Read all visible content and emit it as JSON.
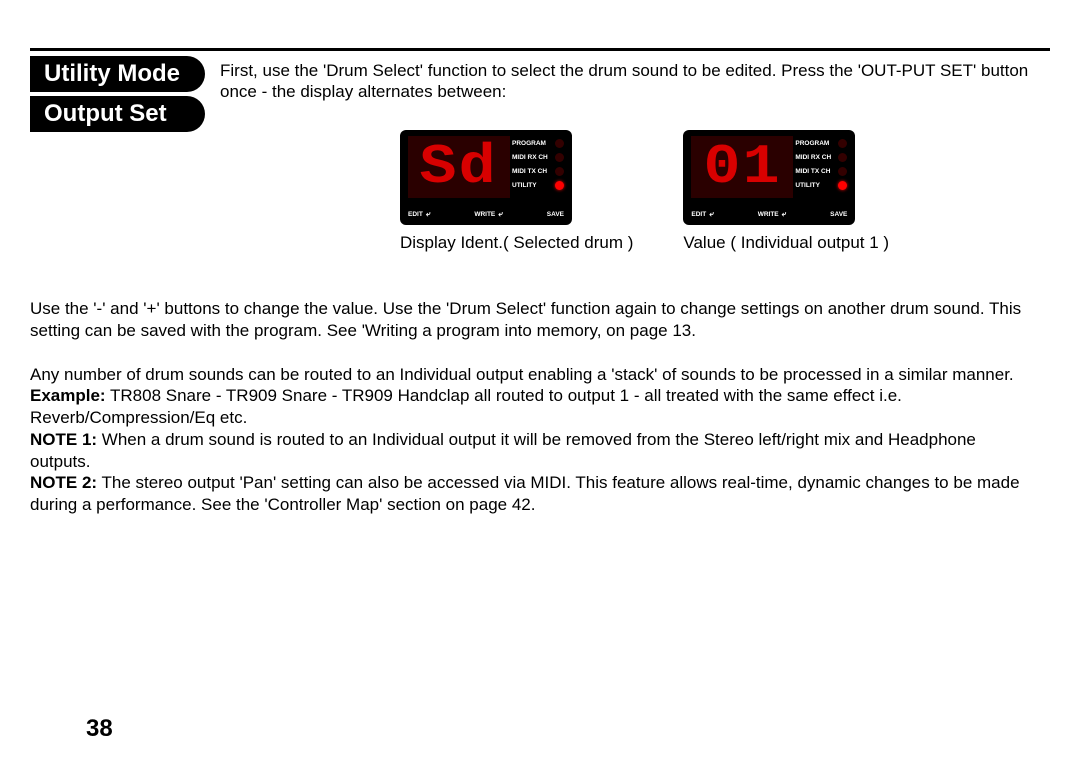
{
  "heading": {
    "line1": "Utility Mode",
    "line2": "Output Set"
  },
  "intro_text": "First, use the 'Drum Select' function to select the drum sound to be edited. Press the 'OUT-PUT SET' button once - the display alternates between:",
  "display_labels": {
    "row1": "PROGRAM",
    "row2": "MIDI RX CH",
    "row3": "MIDI TX CH",
    "row4": "UTILITY",
    "b1": "EDIT",
    "b2": "WRITE",
    "b3": "SAVE"
  },
  "display1": {
    "seg": "Sd",
    "caption": "Display Ident.( Selected drum )"
  },
  "display2": {
    "seg": "01",
    "caption": "Value ( Individual output 1 )"
  },
  "para1": "Use the '-' and '+' buttons to change the value. Use the 'Drum Select' function again to change settings on another drum sound. This setting can be saved with the program. See 'Writing a program into memory, on page 13.",
  "para2a": "Any number of drum sounds can be routed to an Individual output enabling a 'stack' of sounds to be processed in a similar manner.",
  "example_label": "Example:",
  "para2b": " TR808 Snare - TR909 Snare - TR909 Handclap all routed to output 1 - all treated with the same effect i.e. Reverb/Compression/Eq etc.",
  "note1_label": "NOTE 1:",
  "note1_text": " When a drum sound is routed to an Individual output it will be removed from the Stereo left/right mix and Headphone outputs.",
  "note2_label": "NOTE 2:",
  "note2_text": " The stereo output 'Pan' setting can also be accessed via MIDI. This feature allows real-time, dynamic changes to be made during a performance. See the 'Controller Map' section on page 42.",
  "page_number": "38"
}
